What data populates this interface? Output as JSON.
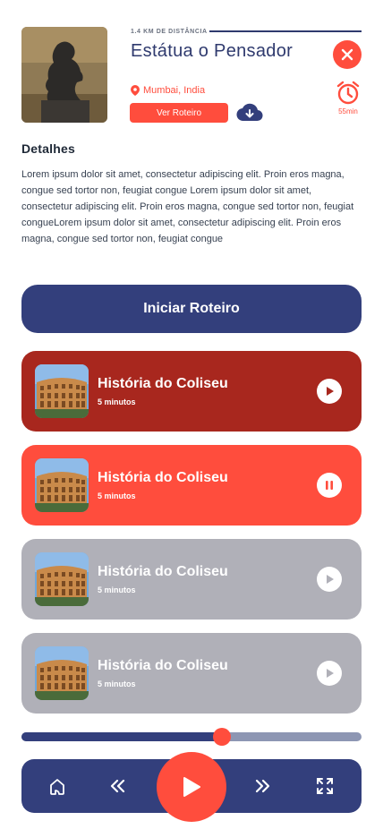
{
  "header": {
    "distance_label": "1.4 KM DE DISTÂNCIA",
    "title": "Estátua o Pensador",
    "location": "Mumbai, India",
    "route_button": "Ver Roteiro",
    "timer_label": "55min",
    "hero_image": "the-thinker-statue"
  },
  "details": {
    "heading": "Detalhes",
    "text": "Lorem ipsum dolor sit amet, consectetur adipiscing elit. Proin eros magna, congue sed tortor non, feugiat congue Lorem ipsum dolor sit amet, consectetur adipiscing elit. Proin eros magna, congue sed tortor non, feugiat congueLorem ipsum dolor sit amet, consectetur adipiscing elit. Proin eros magna, congue sed tortor non, feugiat congue"
  },
  "start_button": "Iniciar Roteiro",
  "tracks": [
    {
      "title": "História do Coliseu",
      "duration": "5 minutos",
      "state": "play",
      "color": "#a8271e"
    },
    {
      "title": "História do Coliseu",
      "duration": "5 minutos",
      "state": "pause",
      "color": "#ff4d3d"
    },
    {
      "title": "História do Coliseu",
      "duration": "5 minutos",
      "state": "play",
      "color": "#b0b0b8"
    },
    {
      "title": "História do Coliseu",
      "duration": "5 minutos",
      "state": "play",
      "color": "#b0b0b8"
    }
  ],
  "playback": {
    "progress": 0.59
  },
  "colors": {
    "accent": "#ff4d3d",
    "primary": "#333f7c",
    "dark_red": "#a8271e",
    "inactive": "#b0b0b8"
  },
  "player_icons": [
    "home-icon",
    "rewind-icon",
    "play-icon",
    "fast-forward-icon",
    "fullscreen-icon"
  ]
}
